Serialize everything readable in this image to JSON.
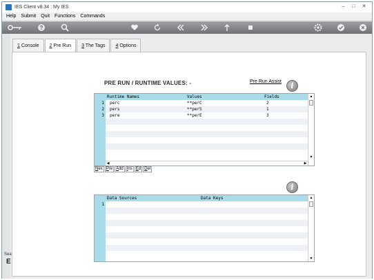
{
  "window": {
    "title": "IES Client v8.34 : My IES",
    "controls": [
      "–",
      "□",
      "✕"
    ]
  },
  "menu": [
    "Help",
    "Submit",
    "Quit",
    "Functions",
    "Commands"
  ],
  "toolbar": {
    "icons": [
      "key-icon",
      "help-icon",
      "search-icon",
      "heart-icon",
      "refresh-icon",
      "rewind-icon",
      "fast-forward-icon",
      "upload-icon",
      "stop-icon",
      "settings-icon",
      "check-icon",
      "close-icon"
    ]
  },
  "sidebar": {
    "label": "Sea",
    "glyph": "E"
  },
  "tabs": [
    {
      "key": "1",
      "label": " Console"
    },
    {
      "key": "2",
      "label": " Pre Run"
    },
    {
      "key": "3",
      "label": " The Tags"
    },
    {
      "key": "4",
      "label": " Options"
    }
  ],
  "prerun": {
    "title": "PRE RUN / RUNTIME VALUES: -",
    "assist_link": "Pre Run Assist",
    "runtime_grid": {
      "headers": [
        "Runtime Names",
        "Values",
        "Fields"
      ],
      "rows": [
        {
          "num": "1",
          "name": "perc",
          "value": "**perC",
          "field": "2"
        },
        {
          "num": "2",
          "name": "pers",
          "value": "**perS",
          "field": "1"
        },
        {
          "num": "3",
          "name": "pere",
          "value": "**perE",
          "field": "3"
        }
      ]
    },
    "grid_buttons": [
      {
        "key": "N",
        "rest": "ex"
      },
      {
        "key": "P",
        "rest": "re"
      },
      {
        "key": "A",
        "rest": "dd"
      },
      {
        "key": "I",
        "rest": "ns"
      },
      {
        "key": "E",
        "rest": "d"
      },
      {
        "key": "D",
        "rest": "el"
      }
    ],
    "sources_grid": {
      "headers": [
        "Data Sources",
        "Data Keys"
      ],
      "rows": [
        {
          "num": "1",
          "source": "",
          "keys": ""
        }
      ]
    }
  }
}
